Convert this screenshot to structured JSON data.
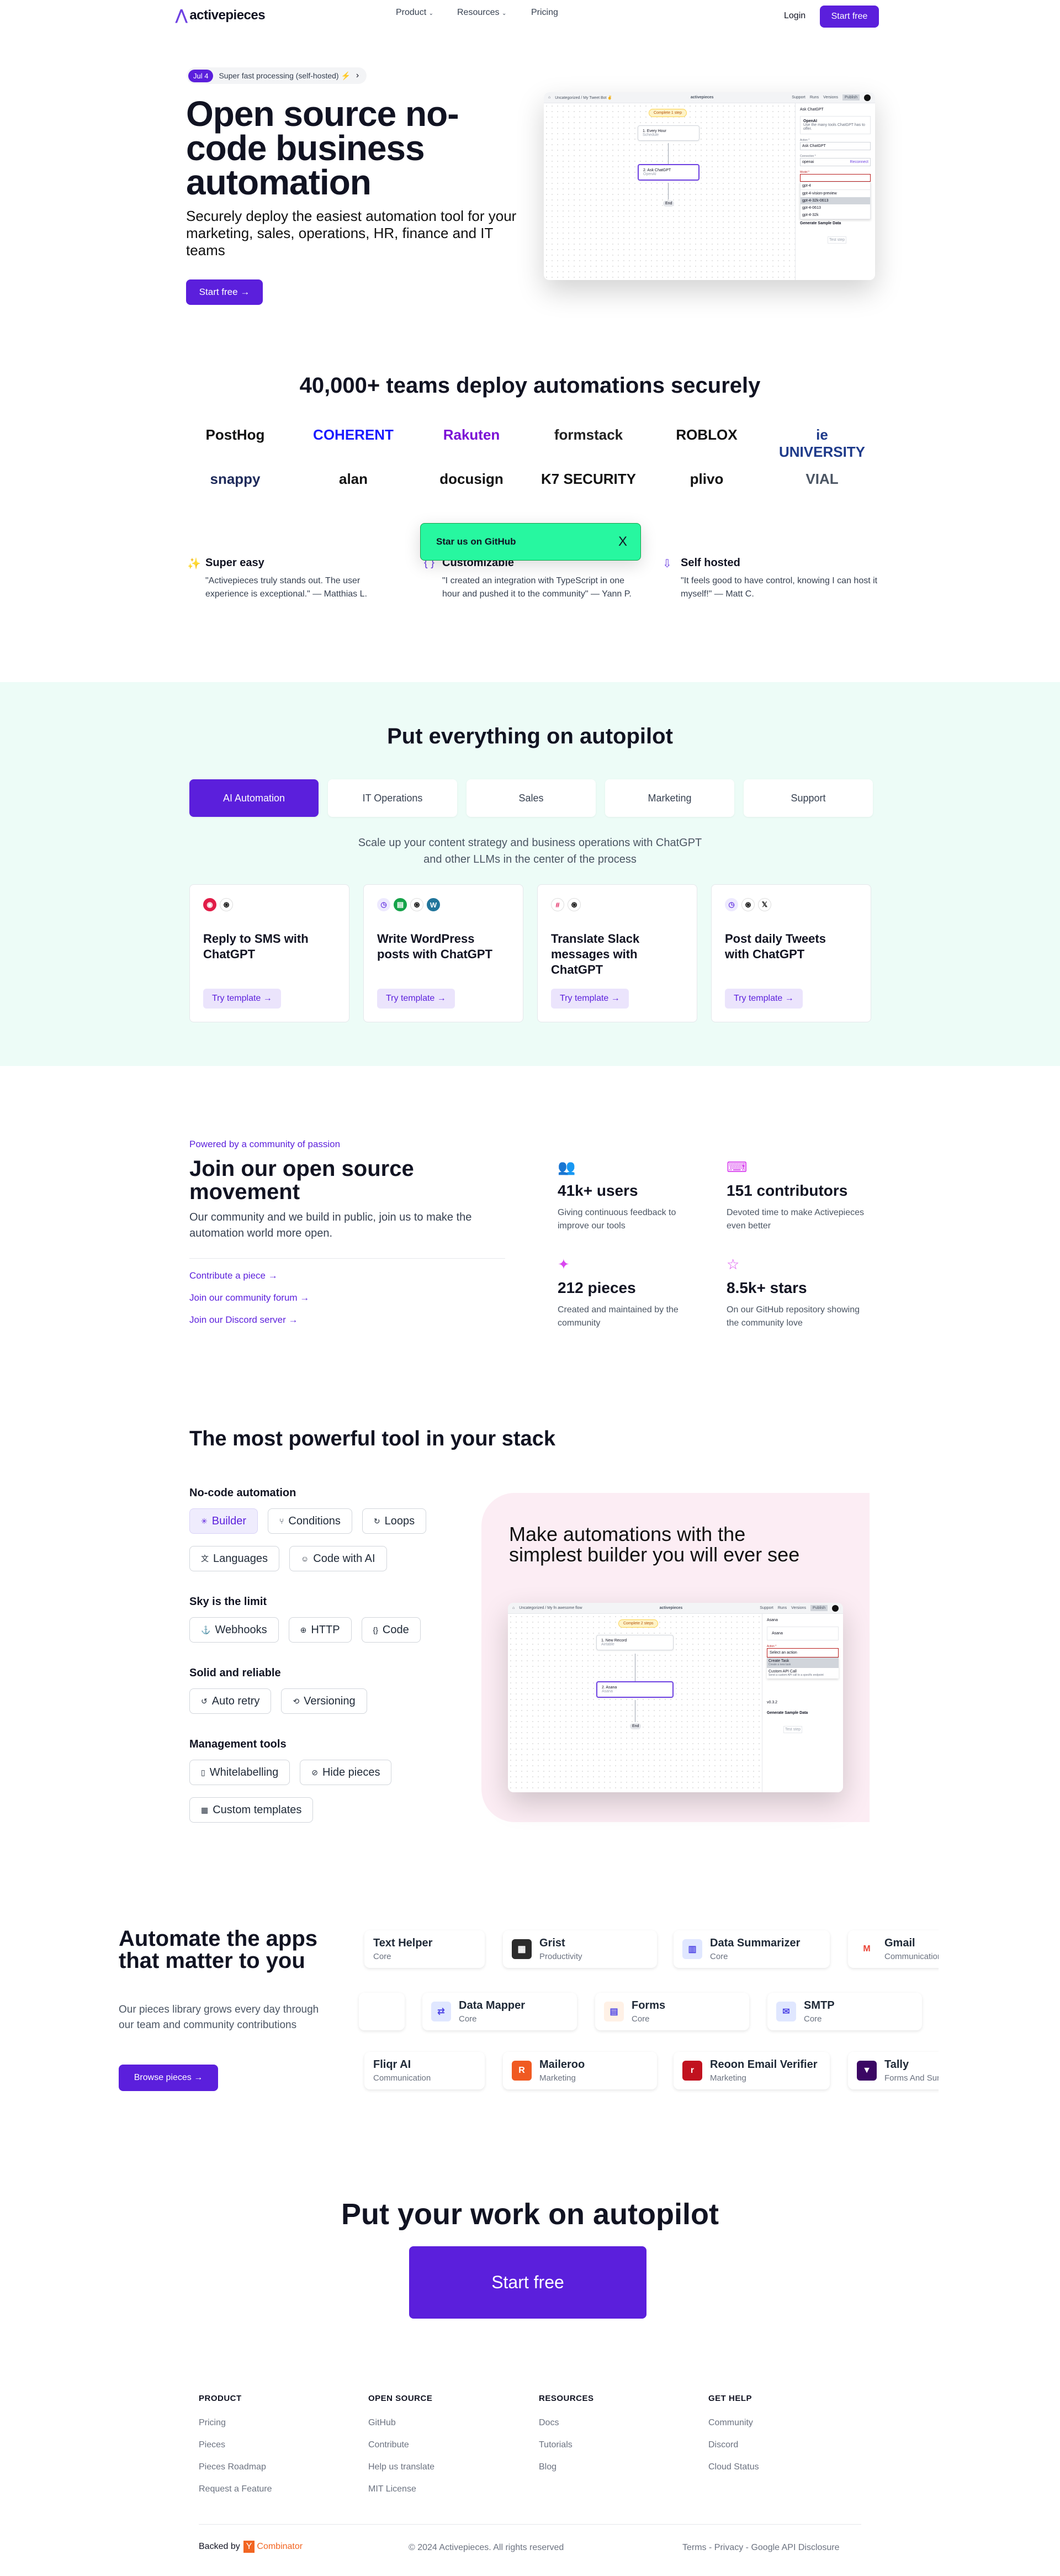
{
  "nav": {
    "brand": "activepieces",
    "links": [
      {
        "label": "Product",
        "dropdown": true
      },
      {
        "label": "Resources",
        "dropdown": true
      },
      {
        "label": "Pricing",
        "dropdown": false
      }
    ],
    "login": "Login",
    "start_free": "Start free"
  },
  "hero": {
    "badge_date": "Jul 4",
    "badge_text": "Super fast processing (self-hosted) ⚡",
    "title": "Open source no-code business automation",
    "subtitle": "Securely deploy the easiest automation tool for your marketing, sales, operations, HR, finance and IT teams",
    "cta": "Start free →",
    "mock": {
      "breadcrumb": "Uncategorized / My Tweet Bot ✌",
      "brand": "activepieces",
      "top_actions": [
        "Support",
        "Runs",
        "Versions",
        "Publish"
      ],
      "pill": "Complete 1 step",
      "node1_title": "1. Every Hour",
      "node1_sub": "Schedule",
      "node2_title": "2. Ask ChatGPT",
      "node2_sub": "OpenAI",
      "end": "End",
      "panel_title": "Ask ChatGPT",
      "piece_name": "OpenAI",
      "piece_desc": "Use the many tools ChatGPT has to offer.",
      "action_label": "Action *",
      "action_value": "Ask ChatGPT",
      "connection_label": "Connection *",
      "connection_value": "openai",
      "reconnect": "Reconnect",
      "model_label": "Model *",
      "search_value": "gpt-4",
      "options": [
        "gpt-4-vision-preview",
        "gpt-4-32k-0613",
        "gpt-4-0613",
        "gpt-4-32k"
      ],
      "generate": "Generate Sample Data",
      "test": "Test step"
    }
  },
  "trust": {
    "title": "40,000+ teams deploy automations securely",
    "logos": [
      {
        "name": "PostHog",
        "color": "#111"
      },
      {
        "name": "COHERENT",
        "color": "#1a1aff"
      },
      {
        "name": "Rakuten",
        "color": "#7b0fd6"
      },
      {
        "name": "formstack",
        "color": "#222"
      },
      {
        "name": "ROBLOX",
        "color": "#111"
      },
      {
        "name": "ie UNIVERSITY",
        "color": "#1e3a8a"
      },
      {
        "name": "snappy",
        "color": "#1e2a5a"
      },
      {
        "name": "alan",
        "color": "#111"
      },
      {
        "name": "docusign",
        "color": "#111"
      },
      {
        "name": "K7 SECURITY",
        "color": "#111"
      },
      {
        "name": "plivo",
        "color": "#111"
      },
      {
        "name": "VIAL",
        "color": "#4b5563"
      }
    ]
  },
  "toast": {
    "label": "Star us on GitHub",
    "close": "X",
    "color": "#27f7a0"
  },
  "features": [
    {
      "icon": "party-popper",
      "title": "Super easy",
      "quote": "\"Activepieces truly stands out. The user experience is exceptional.\" — Matthias L."
    },
    {
      "icon": "braces",
      "title": "Customizable",
      "quote": "\"I created an integration with TypeScript in one hour and pushed it to the community\" — Yann P."
    },
    {
      "icon": "monitor-download",
      "title": "Self hosted",
      "quote": "\"It feels good to have control, knowing I can host it myself!\" — Matt C."
    }
  ],
  "autopilot": {
    "title": "Put everything on autopilot",
    "bg": "#edfcf7",
    "tabs": [
      {
        "label": "AI Automation",
        "active": true
      },
      {
        "label": "IT Operations"
      },
      {
        "label": "Sales"
      },
      {
        "label": "Marketing"
      },
      {
        "label": "Support"
      }
    ],
    "description": "Scale up your content strategy and business operations with ChatGPT and other LLMs in the center of the process",
    "cards": [
      {
        "title": "Reply to SMS with ChatGPT",
        "icons": [
          "twilio",
          "openai"
        ],
        "cta": "Try template →"
      },
      {
        "title": "Write WordPress posts with ChatGPT",
        "icons": [
          "schedule",
          "google-sheets",
          "openai",
          "wordpress"
        ],
        "cta": "Try template →"
      },
      {
        "title": "Translate Slack messages with ChatGPT",
        "icons": [
          "slack",
          "openai"
        ],
        "cta": "Try template →"
      },
      {
        "title": "Post daily Tweets with ChatGPT",
        "icons": [
          "schedule",
          "openai",
          "x"
        ],
        "cta": "Try template →"
      }
    ]
  },
  "community": {
    "eyebrow": "Powered by a community of passion",
    "title": "Join our open source movement",
    "description": "Our community and we build in public, join us to make the automation world more open.",
    "links": [
      "Contribute a piece →",
      "Join our community forum →",
      "Join our Discord server →"
    ],
    "stats": [
      {
        "icon": "users-icon",
        "title": "41k+ users",
        "desc": "Giving continuous feedback to improve our tools"
      },
      {
        "icon": "code-monitor-icon",
        "title": "151 contributors",
        "desc": "Devoted time to make Activepieces even better"
      },
      {
        "icon": "puzzle-icon",
        "title": "212 pieces",
        "desc": "Created and maintained by the community"
      },
      {
        "icon": "star-icon",
        "title": "8.5k+ stars",
        "desc": "On our GitHub repository showing the community love"
      }
    ]
  },
  "tools": {
    "title": "The most powerful tool in your stack",
    "groups": [
      {
        "title": "No-code automation",
        "rows": [
          [
            {
              "icon": "✳",
              "label": "Builder",
              "active": true
            },
            {
              "icon": "⑂",
              "label": "Conditions"
            },
            {
              "icon": "↻",
              "label": "Loops"
            }
          ],
          [
            {
              "icon": "文",
              "label": "Languages"
            },
            {
              "icon": "☺",
              "label": "Code with AI"
            }
          ]
        ]
      },
      {
        "title": "Sky is the limit",
        "rows": [
          [
            {
              "icon": "⚓",
              "label": "Webhooks"
            },
            {
              "icon": "⊕",
              "label": "HTTP"
            },
            {
              "icon": "{}",
              "label": "Code"
            }
          ]
        ]
      },
      {
        "title": "Solid and reliable",
        "rows": [
          [
            {
              "icon": "↺",
              "label": "Auto retry"
            },
            {
              "icon": "⟲",
              "label": "Versioning"
            }
          ]
        ]
      },
      {
        "title": "Management tools",
        "rows": [
          [
            {
              "icon": "▯",
              "label": "Whitelabelling"
            },
            {
              "icon": "⊘",
              "label": "Hide pieces"
            }
          ],
          [
            {
              "icon": "▦",
              "label": "Custom templates"
            }
          ]
        ]
      }
    ],
    "panel": {
      "title": "Make automations with the simplest builder you will ever see",
      "bg": "#fcedf4",
      "mock": {
        "breadcrumb": "Uncategorized / My fn awesome flow",
        "brand": "activepieces",
        "top_actions": [
          "Support",
          "Runs",
          "Versions",
          "Publish"
        ],
        "pill": "Complete 2 steps",
        "node1_title": "1. New Record",
        "node1_sub": "Airtable",
        "node2_title": "2. Asana",
        "node2_sub": "Asana",
        "end": "End",
        "panel_title": "Asana",
        "piece_name": "Asana",
        "action_label": "Action *",
        "action_value": "Select an action",
        "options": [
          {
            "t": "Create Task",
            "d": "Create a new task"
          },
          {
            "t": "Custom API Call",
            "d": "Send a custom API call to a specific endpoint"
          }
        ],
        "version": "v0.3.2",
        "generate": "Generate Sample Data",
        "test": "Test step"
      }
    }
  },
  "apps": {
    "title": "Automate the apps that matter to you",
    "description": "Our pieces library grows every day through our team and community contributions",
    "cta": "Browse pieces →",
    "rows": [
      [
        {
          "name": "Text Helper",
          "category": "Core",
          "color": ""
        },
        {
          "name": "Grist",
          "category": "Productivity",
          "color": "#2b2b2b"
        },
        {
          "name": "Data Summarizer",
          "category": "Core",
          "color": "#e0e7ff"
        },
        {
          "name": "Gmail",
          "category": "Communication",
          "color": "#ffffff"
        }
      ],
      [
        {
          "name": "",
          "category": "",
          "color": ""
        },
        {
          "name": "Data Mapper",
          "category": "Core",
          "color": "#e0e7ff"
        },
        {
          "name": "Forms",
          "category": "Core",
          "color": "#fff1e6"
        },
        {
          "name": "SMTP",
          "category": "Core",
          "color": "#e0e7ff"
        }
      ],
      [
        {
          "name": "Fliqr AI",
          "category": "Communication",
          "color": ""
        },
        {
          "name": "Maileroo",
          "category": "Marketing",
          "color": "#f05a22"
        },
        {
          "name": "Reoon Email Verifier",
          "category": "Marketing",
          "color": "#c1121f"
        },
        {
          "name": "Tally",
          "category": "Forms And Surveys",
          "color": "#3b0764"
        }
      ]
    ]
  },
  "cta": {
    "title": "Put your work on autopilot",
    "button": "Start free"
  },
  "footer": {
    "columns": [
      {
        "title": "PRODUCT",
        "links": [
          "Pricing",
          "Pieces",
          "Pieces Roadmap",
          "Request a Feature"
        ]
      },
      {
        "title": "OPEN SOURCE",
        "links": [
          "GitHub",
          "Contribute",
          "Help us translate",
          "MIT License"
        ]
      },
      {
        "title": "RESOURCES",
        "links": [
          "Docs",
          "Tutorials",
          "Blog"
        ]
      },
      {
        "title": "GET HELP",
        "links": [
          "Community",
          "Discord",
          "Cloud Status"
        ]
      }
    ],
    "backed_by": "Backed by",
    "yc_letter": "Y",
    "yc_name": "Combinator",
    "copyright": "© 2024 Activepieces. All rights reserved",
    "legal": [
      "Terms",
      "Privacy",
      "Google API Disclosure"
    ]
  },
  "colors": {
    "primary": "#5b1fdc",
    "toast": "#27f7a0",
    "autopilot_bg": "#edfcf7",
    "panel_bg": "#fcedf4",
    "stat_icon": "#d946ef"
  }
}
